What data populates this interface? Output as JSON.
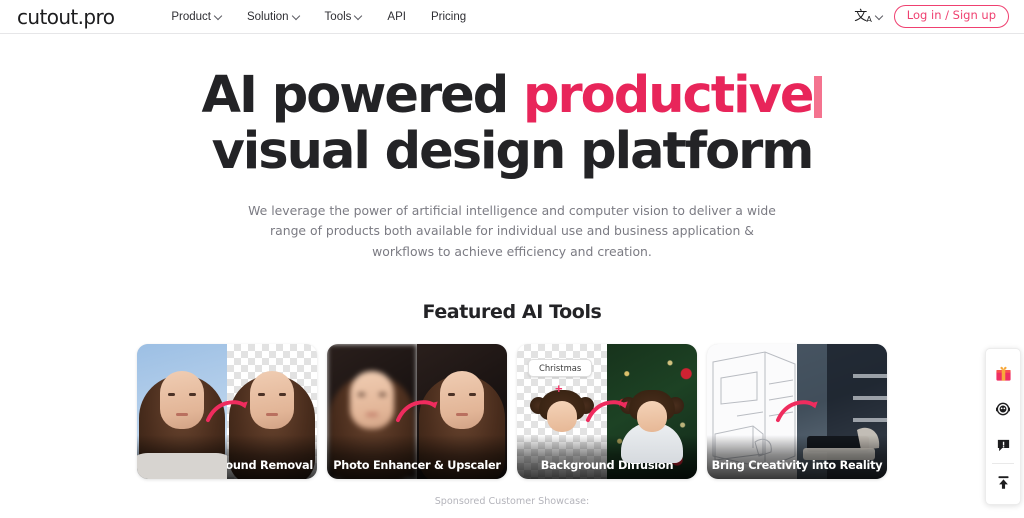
{
  "header": {
    "logo": "cutout.pro",
    "nav": [
      {
        "label": "Product",
        "has_chevron": true
      },
      {
        "label": "Solution",
        "has_chevron": true
      },
      {
        "label": "Tools",
        "has_chevron": true
      },
      {
        "label": "API",
        "has_chevron": false
      },
      {
        "label": "Pricing",
        "has_chevron": false
      }
    ],
    "language_icon": "translate-icon",
    "login_button": "Log in / Sign up",
    "accent_color": "#ef4070"
  },
  "hero": {
    "headline_part1": "AI powered ",
    "headline_accent": "productive",
    "headline_line2": "visual design platform",
    "accent_color": "#e8255a",
    "cursor_color": "#f4738f",
    "subtitle": "We leverage the power of artificial intelligence and computer vision to deliver a wide range of products both available for individual use and business application & workflows to achieve efficiency and creation."
  },
  "featured": {
    "title": "Featured AI Tools",
    "cards": [
      {
        "label": "Image Background Removal",
        "kind": "bg-removal"
      },
      {
        "label": "Photo Enhancer & Upscaler",
        "kind": "enhancer"
      },
      {
        "label": "Background Diffusion",
        "kind": "diffusion",
        "prompt_chip": "Christmas",
        "plus": "+"
      },
      {
        "label": "Bring Creativity into Reality",
        "kind": "interior"
      }
    ]
  },
  "float_toolbar": {
    "items": [
      {
        "icon": "gift-icon",
        "name": "gift"
      },
      {
        "icon": "support-agent-icon",
        "name": "support"
      },
      {
        "icon": "feedback-icon",
        "name": "feedback"
      },
      {
        "icon": "back-to-top-icon",
        "name": "back-to-top"
      }
    ]
  },
  "footer": {
    "sponsored_label": "Sponsored Customer Showcase:"
  }
}
